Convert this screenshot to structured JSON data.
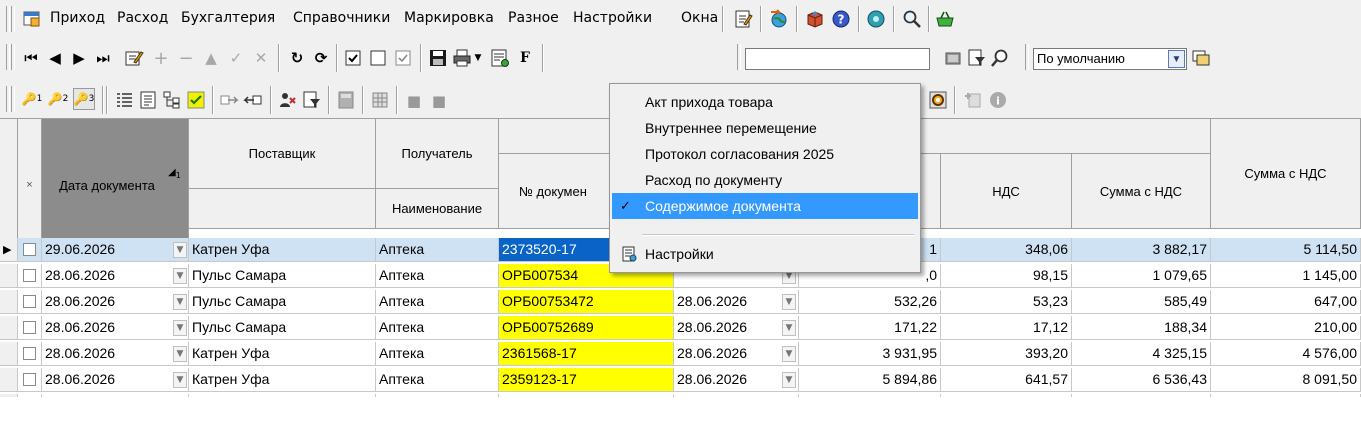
{
  "menubar": {
    "items": [
      "Приход",
      "Расход",
      "Бухгалтерия",
      "Справочники",
      "Маркировка",
      "Разное",
      "Настройки",
      "Окна"
    ]
  },
  "toolbar2": {
    "filter_select_value": "По умолчанию"
  },
  "toolbar3": {
    "tab_icons": [
      "tab-1-icon",
      "tab-2-icon",
      "tab-3-icon"
    ],
    "tab_labels": [
      "1",
      "2",
      "3"
    ]
  },
  "popup": {
    "items": [
      {
        "label": "Акт прихода товара",
        "checked": false,
        "highlighted": false
      },
      {
        "label": "Внутреннее перемещение",
        "checked": false,
        "highlighted": false
      },
      {
        "label": "Протокол согласования 2025",
        "checked": false,
        "highlighted": false
      },
      {
        "label": "Расход по документу",
        "checked": false,
        "highlighted": false
      },
      {
        "label": "Содержимое документа",
        "checked": true,
        "highlighted": true
      }
    ],
    "settings_label": "Настройки"
  },
  "grid": {
    "headers": {
      "mark": "×",
      "date": "Дата документа",
      "sort_indicator": "1",
      "supplier": "Поставщик",
      "recipient": "Получатель",
      "recipient_sub": "Наименование",
      "doc_no": "№ докумен",
      "vat": "НДС",
      "sum_vat": "Сумма с НДС",
      "sum_vat2": "Сумма с НДС"
    },
    "rows": [
      {
        "date": "29.06.2026",
        "supplier": "Катрен Уфа",
        "recipient": "Аптека",
        "doc_no": "2373520-17",
        "doc_date": "",
        "amount": "1",
        "vat": "348,06",
        "sum_vat": "3 882,17",
        "sum_vat2": "5 114,50"
      },
      {
        "date": "28.06.2026",
        "supplier": "Пульс Самара",
        "recipient": "Аптека",
        "doc_no": "ОРБ007534",
        "doc_date": "",
        "amount": ",0",
        "vat": "98,15",
        "sum_vat": "1 079,65",
        "sum_vat2": "1 145,00"
      },
      {
        "date": "28.06.2026",
        "supplier": "Пульс Самара",
        "recipient": "Аптека",
        "doc_no": "ОРБ00753472",
        "doc_date": "28.06.2026",
        "amount": "532,26",
        "vat": "53,23",
        "sum_vat": "585,49",
        "sum_vat2": "647,00"
      },
      {
        "date": "28.06.2026",
        "supplier": "Пульс Самара",
        "recipient": "Аптека",
        "doc_no": "ОРБ00752689",
        "doc_date": "28.06.2026",
        "amount": "171,22",
        "vat": "17,12",
        "sum_vat": "188,34",
        "sum_vat2": "210,00"
      },
      {
        "date": "28.06.2026",
        "supplier": "Катрен Уфа",
        "recipient": "Аптека",
        "doc_no": "2361568-17",
        "doc_date": "28.06.2026",
        "amount": "3 931,95",
        "vat": "393,20",
        "sum_vat": "4 325,15",
        "sum_vat2": "4 576,00"
      },
      {
        "date": "28.06.2026",
        "supplier": "Катрен Уфа",
        "recipient": "Аптека",
        "doc_no": "2359123-17",
        "doc_date": "28.06.2026",
        "amount": "5 894,86",
        "vat": "641,57",
        "sum_vat": "6 536,43",
        "sum_vat2": "8 091,50"
      }
    ]
  },
  "colors": {
    "highlight_yellow": "#ffff00",
    "selected_row": "#cfe2f3",
    "focus_cell": "#0a64c8",
    "menu_highlight": "#3399ff"
  }
}
